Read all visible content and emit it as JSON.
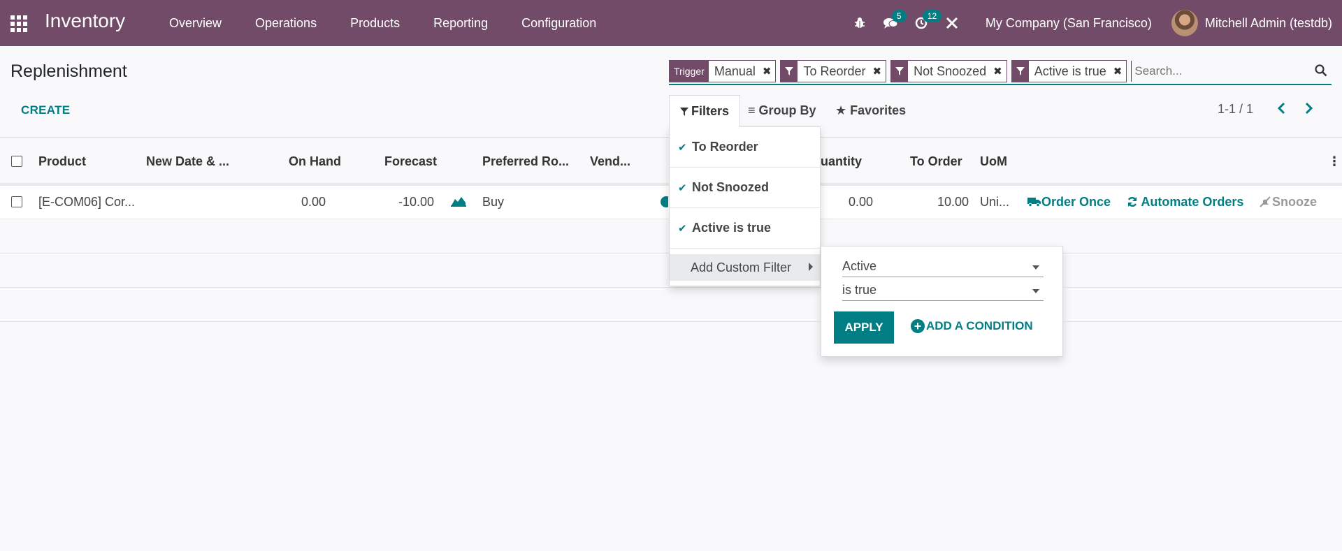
{
  "navbar": {
    "app_name": "Inventory",
    "menu": [
      "Overview",
      "Operations",
      "Products",
      "Reporting",
      "Configuration"
    ],
    "messages_count": "5",
    "activities_count": "12",
    "company": "My Company (San Francisco)",
    "user": "Mitchell Admin (testdb)"
  },
  "page": {
    "title": "Replenishment",
    "create_label": "CREATE"
  },
  "search": {
    "facets": [
      {
        "label": "Trigger",
        "value": "Manual"
      },
      {
        "label": "filter",
        "value": "To Reorder"
      },
      {
        "label": "filter",
        "value": "Not Snoozed"
      },
      {
        "label": "filter",
        "value": "Active is true"
      }
    ],
    "placeholder": "Search..."
  },
  "controls": {
    "filters": "Filters",
    "group_by": "Group By",
    "favorites": "Favorites",
    "pager": "1-1 / 1"
  },
  "table": {
    "headers": {
      "product": "Product",
      "new_date": "New Date & ...",
      "on_hand": "On Hand",
      "forecast": "Forecast",
      "preferred_route": "Preferred Ro...",
      "vendor": "Vend...",
      "quantity": "Quantity",
      "to_order": "To Order",
      "uom": "UoM"
    },
    "rows": [
      {
        "product": "[E-COM06] Cor...",
        "on_hand": "0.00",
        "forecast": "-10.00",
        "route": "Buy",
        "quantity": "0.00",
        "to_order": "10.00",
        "uom": "Uni...",
        "order_once": "Order Once",
        "automate": "Automate Orders",
        "snooze": "Snooze"
      }
    ]
  },
  "filters_dropdown": {
    "items": [
      "To Reorder",
      "Not Snoozed",
      "Active is true"
    ],
    "custom": "Add Custom Filter"
  },
  "custom_filter": {
    "field": "Active",
    "operator": "is true",
    "apply": "APPLY",
    "add_condition": "ADD A CONDITION"
  },
  "colors": {
    "brand": "#714b67",
    "accent": "#017e84"
  }
}
